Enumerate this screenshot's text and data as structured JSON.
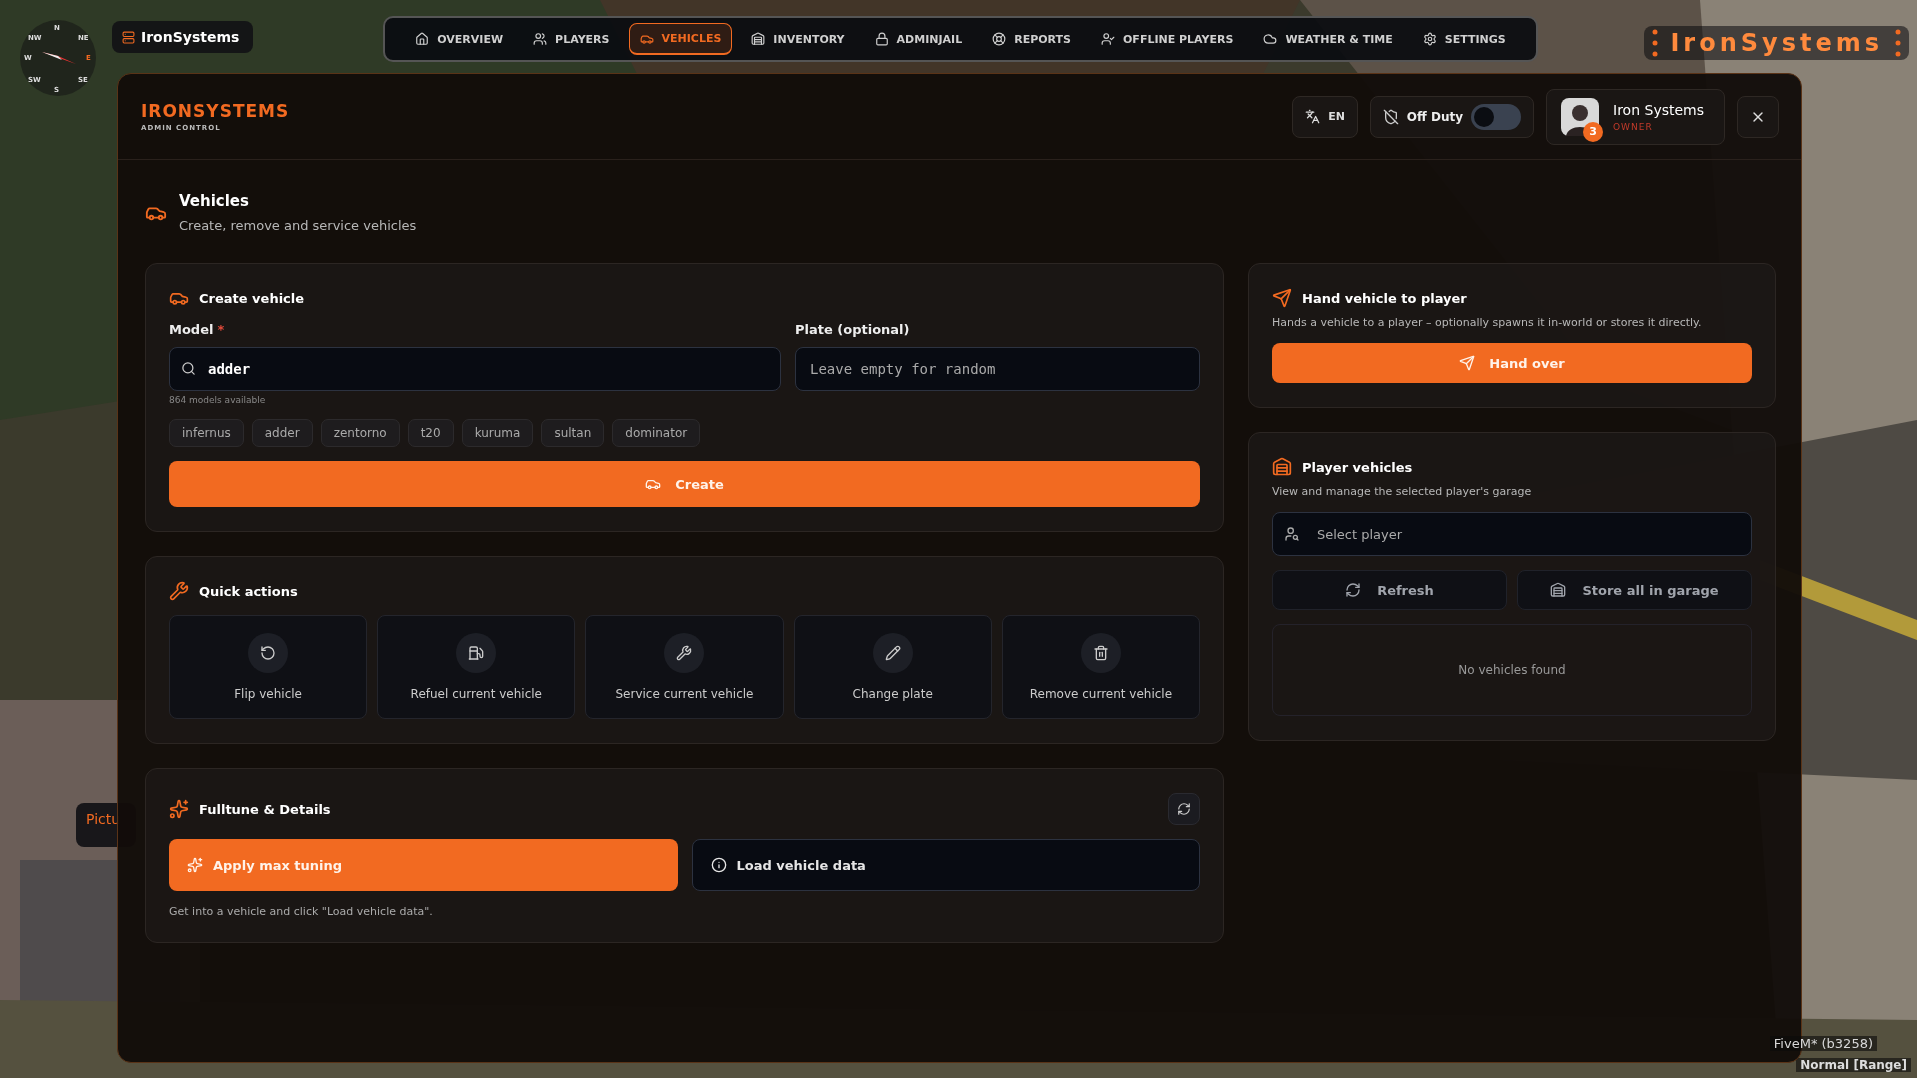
{
  "hud": {
    "compass": [
      "N",
      "NW",
      "NE",
      "W",
      "E",
      "SW",
      "SE",
      "S"
    ],
    "server_tag": "IronSystems",
    "brand": "IronSystems",
    "side_tag": "Pictu",
    "build": "FiveM* (b3258)",
    "voice": "Normal [Range]"
  },
  "nav": [
    {
      "label": "OVERVIEW",
      "selected": false
    },
    {
      "label": "PLAYERS",
      "selected": false
    },
    {
      "label": "VEHICLES",
      "selected": true
    },
    {
      "label": "INVENTORY",
      "selected": false
    },
    {
      "label": "ADMINJAIL",
      "selected": false
    },
    {
      "label": "REPORTS",
      "selected": false
    },
    {
      "label": "OFFLINE PLAYERS",
      "selected": false
    },
    {
      "label": "WEATHER & TIME",
      "selected": false
    },
    {
      "label": "SETTINGS",
      "selected": false
    }
  ],
  "header": {
    "logo": "IRONSYSTEMS",
    "subtitle": "ADMIN CONTROL",
    "language": "EN",
    "duty": {
      "label": "Off Duty",
      "on": false
    },
    "user": {
      "name": "Iron Systems",
      "role": "OWNER",
      "badge": "3"
    }
  },
  "page": {
    "title": "Vehicles",
    "subtitle": "Create, remove and service vehicles"
  },
  "create": {
    "title": "Create vehicle",
    "model_label": "Model",
    "required_mark": "*",
    "model_value": "adder",
    "plate_label": "Plate (optional)",
    "plate_placeholder": "Leave empty for random",
    "hint": "864 models available",
    "chips": [
      "infernus",
      "adder",
      "zentorno",
      "t20",
      "kuruma",
      "sultan",
      "dominator"
    ],
    "button": "Create"
  },
  "quick": {
    "title": "Quick actions",
    "actions": [
      "Flip vehicle",
      "Refuel current vehicle",
      "Service current vehicle",
      "Change plate",
      "Remove current vehicle"
    ]
  },
  "tune": {
    "title": "Fulltune & Details",
    "apply": "Apply max tuning",
    "load": "Load vehicle data",
    "hint": "Get into a vehicle and click \"Load vehicle data\"."
  },
  "hand": {
    "title": "Hand vehicle to player",
    "text": "Hands a vehicle to a player – optionally spawns it in-world or stores it directly.",
    "button": "Hand over"
  },
  "garage": {
    "title": "Player vehicles",
    "text": "View and manage the selected player's garage",
    "placeholder": "Select player",
    "refresh": "Refresh",
    "store": "Store all in garage",
    "empty": "No vehicles found"
  }
}
